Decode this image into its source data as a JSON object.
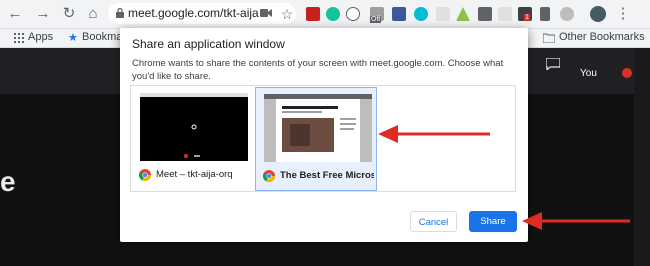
{
  "browser": {
    "url": "meet.google.com/tkt-aija",
    "bookmarks": {
      "apps_label": "Apps",
      "bookmarks_label": "Bookmark",
      "other_label": "Other Bookmarks"
    },
    "extension_badge": "Off",
    "extension_badge2": "1"
  },
  "meet": {
    "you_label": "You",
    "left_glyph": "e"
  },
  "dialog": {
    "title": "Share an application window",
    "description": "Chrome wants to share the contents of your screen with meet.google.com. Choose what you'd like to share.",
    "windows": [
      {
        "label": "Meet – tkt-aija-orq",
        "selected": false
      },
      {
        "label": "The Best Free Micros…",
        "selected": true
      }
    ],
    "cancel_label": "Cancel",
    "share_label": "Share"
  },
  "colors": {
    "accent": "#1a73e8",
    "arrow": "#e02b20"
  }
}
